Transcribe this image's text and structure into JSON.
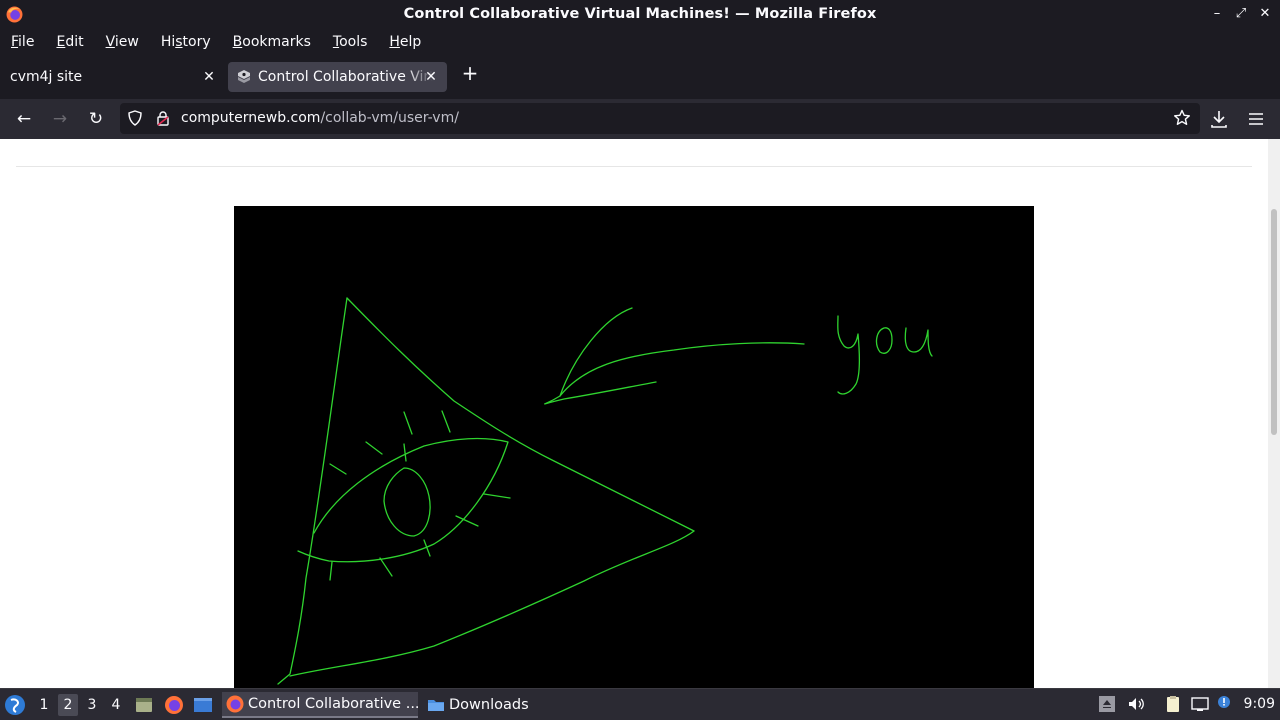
{
  "window": {
    "title": "Control Collaborative Virtual Machines! — Mozilla Firefox",
    "minimize_glyph": "–",
    "restore_glyph": "⤢",
    "close_glyph": "✕"
  },
  "menubar": {
    "items": [
      {
        "pre": "",
        "ul": "F",
        "post": "ile"
      },
      {
        "pre": "",
        "ul": "E",
        "post": "dit"
      },
      {
        "pre": "",
        "ul": "V",
        "post": "iew"
      },
      {
        "pre": "Hi",
        "ul": "s",
        "post": "tory"
      },
      {
        "pre": "",
        "ul": "B",
        "post": "ookmarks"
      },
      {
        "pre": "",
        "ul": "T",
        "post": "ools"
      },
      {
        "pre": "",
        "ul": "H",
        "post": "elp"
      }
    ]
  },
  "tabs": [
    {
      "title": "cvm4j site",
      "active": false,
      "close": "✕"
    },
    {
      "title": "Control Collaborative Virtual Machines!",
      "active": true,
      "close": "✕"
    }
  ],
  "newtab_glyph": "+",
  "navbar": {
    "back_glyph": "←",
    "forward_glyph": "→",
    "reload_glyph": "↻",
    "url_host": "computernewb.com",
    "url_path": "/collab-vm/user-vm/"
  },
  "vm": {
    "drawing_text": "you",
    "stroke_color": "#2fd32f"
  },
  "taskbar": {
    "workspaces": [
      "1",
      "2",
      "3",
      "4"
    ],
    "active_workspace": "2",
    "tasks": [
      {
        "label": "Control Collaborative ...",
        "icon": "firefox-icon",
        "active": true
      },
      {
        "label": "Downloads",
        "icon": "folder-icon",
        "active": false
      }
    ],
    "clock": "9:09"
  }
}
